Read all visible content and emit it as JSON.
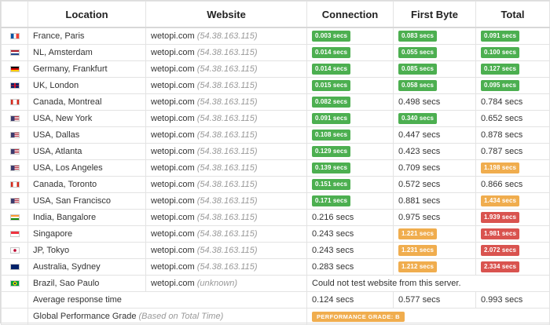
{
  "headers": {
    "location": "Location",
    "website": "Website",
    "connection": "Connection",
    "first_byte": "First Byte",
    "total": "Total"
  },
  "colors": {
    "good": "#4caf50",
    "warn": "#f0ad4e",
    "bad": "#d9534f"
  },
  "rows": [
    {
      "flag": "fr",
      "location": "France, Paris",
      "site": "wetopi.com",
      "ip": "(54.38.163.115)",
      "connection": {
        "text": "0.003 secs",
        "status": "good"
      },
      "first_byte": {
        "text": "0.083 secs",
        "status": "good"
      },
      "total": {
        "text": "0.091 secs",
        "status": "good"
      }
    },
    {
      "flag": "nl",
      "location": "NL, Amsterdam",
      "site": "wetopi.com",
      "ip": "(54.38.163.115)",
      "connection": {
        "text": "0.014 secs",
        "status": "good"
      },
      "first_byte": {
        "text": "0.055 secs",
        "status": "good"
      },
      "total": {
        "text": "0.100 secs",
        "status": "good"
      }
    },
    {
      "flag": "de",
      "location": "Germany, Frankfurt",
      "site": "wetopi.com",
      "ip": "(54.38.163.115)",
      "connection": {
        "text": "0.014 secs",
        "status": "good"
      },
      "first_byte": {
        "text": "0.085 secs",
        "status": "good"
      },
      "total": {
        "text": "0.127 secs",
        "status": "good"
      }
    },
    {
      "flag": "uk",
      "location": "UK, London",
      "site": "wetopi.com",
      "ip": "(54.38.163.115)",
      "connection": {
        "text": "0.015 secs",
        "status": "good"
      },
      "first_byte": {
        "text": "0.058 secs",
        "status": "good"
      },
      "total": {
        "text": "0.095 secs",
        "status": "good"
      }
    },
    {
      "flag": "ca",
      "location": "Canada, Montreal",
      "site": "wetopi.com",
      "ip": "(54.38.163.115)",
      "connection": {
        "text": "0.082 secs",
        "status": "good"
      },
      "first_byte": {
        "text": "0.498 secs",
        "status": "plain"
      },
      "total": {
        "text": "0.784 secs",
        "status": "plain"
      }
    },
    {
      "flag": "us",
      "location": "USA, New York",
      "site": "wetopi.com",
      "ip": "(54.38.163.115)",
      "connection": {
        "text": "0.091 secs",
        "status": "good"
      },
      "first_byte": {
        "text": "0.340 secs",
        "status": "good"
      },
      "total": {
        "text": "0.652 secs",
        "status": "plain"
      }
    },
    {
      "flag": "us",
      "location": "USA, Dallas",
      "site": "wetopi.com",
      "ip": "(54.38.163.115)",
      "connection": {
        "text": "0.108 secs",
        "status": "good"
      },
      "first_byte": {
        "text": "0.447 secs",
        "status": "plain"
      },
      "total": {
        "text": "0.878 secs",
        "status": "plain"
      }
    },
    {
      "flag": "us",
      "location": "USA, Atlanta",
      "site": "wetopi.com",
      "ip": "(54.38.163.115)",
      "connection": {
        "text": "0.129 secs",
        "status": "good"
      },
      "first_byte": {
        "text": "0.423 secs",
        "status": "plain"
      },
      "total": {
        "text": "0.787 secs",
        "status": "plain"
      }
    },
    {
      "flag": "us",
      "location": "USA, Los Angeles",
      "site": "wetopi.com",
      "ip": "(54.38.163.115)",
      "connection": {
        "text": "0.139 secs",
        "status": "good"
      },
      "first_byte": {
        "text": "0.709 secs",
        "status": "plain"
      },
      "total": {
        "text": "1.198 secs",
        "status": "warn"
      }
    },
    {
      "flag": "ca",
      "location": "Canada, Toronto",
      "site": "wetopi.com",
      "ip": "(54.38.163.115)",
      "connection": {
        "text": "0.151 secs",
        "status": "good"
      },
      "first_byte": {
        "text": "0.572 secs",
        "status": "plain"
      },
      "total": {
        "text": "0.866 secs",
        "status": "plain"
      }
    },
    {
      "flag": "us",
      "location": "USA, San Francisco",
      "site": "wetopi.com",
      "ip": "(54.38.163.115)",
      "connection": {
        "text": "0.171 secs",
        "status": "good"
      },
      "first_byte": {
        "text": "0.881 secs",
        "status": "plain"
      },
      "total": {
        "text": "1.434 secs",
        "status": "warn"
      }
    },
    {
      "flag": "in",
      "location": "India, Bangalore",
      "site": "wetopi.com",
      "ip": "(54.38.163.115)",
      "connection": {
        "text": "0.216 secs",
        "status": "plain"
      },
      "first_byte": {
        "text": "0.975 secs",
        "status": "plain"
      },
      "total": {
        "text": "1.939 secs",
        "status": "bad"
      }
    },
    {
      "flag": "sg",
      "location": "Singapore",
      "site": "wetopi.com",
      "ip": "(54.38.163.115)",
      "connection": {
        "text": "0.243 secs",
        "status": "plain"
      },
      "first_byte": {
        "text": "1.221 secs",
        "status": "warn"
      },
      "total": {
        "text": "1.981 secs",
        "status": "bad"
      }
    },
    {
      "flag": "jp",
      "location": "JP, Tokyo",
      "site": "wetopi.com",
      "ip": "(54.38.163.115)",
      "connection": {
        "text": "0.243 secs",
        "status": "plain"
      },
      "first_byte": {
        "text": "1.231 secs",
        "status": "warn"
      },
      "total": {
        "text": "2.072 secs",
        "status": "bad"
      }
    },
    {
      "flag": "au",
      "location": "Australia, Sydney",
      "site": "wetopi.com",
      "ip": "(54.38.163.115)",
      "connection": {
        "text": "0.283 secs",
        "status": "plain"
      },
      "first_byte": {
        "text": "1.212 secs",
        "status": "warn"
      },
      "total": {
        "text": "2.334 secs",
        "status": "bad"
      }
    }
  ],
  "brazil": {
    "flag": "br",
    "location": "Brazil, Sao Paulo",
    "site": "wetopi.com",
    "ip": "(unknown)",
    "message": "Could not test website from this server."
  },
  "average": {
    "label": "Average response time",
    "connection": "0.124 secs",
    "first_byte": "0.577 secs",
    "total": "0.993 secs"
  },
  "grade": {
    "label": "Global Performance Grade",
    "note": "(Based on Total Time)",
    "badge": "PERFORMANCE GRADE:  B"
  },
  "flag_icons": {
    "fr": "france-flag-icon",
    "nl": "netherlands-flag-icon",
    "de": "germany-flag-icon",
    "uk": "uk-flag-icon",
    "ca": "canada-flag-icon",
    "us": "usa-flag-icon",
    "in": "india-flag-icon",
    "sg": "singapore-flag-icon",
    "jp": "japan-flag-icon",
    "au": "australia-flag-icon",
    "br": "brazil-flag-icon"
  }
}
